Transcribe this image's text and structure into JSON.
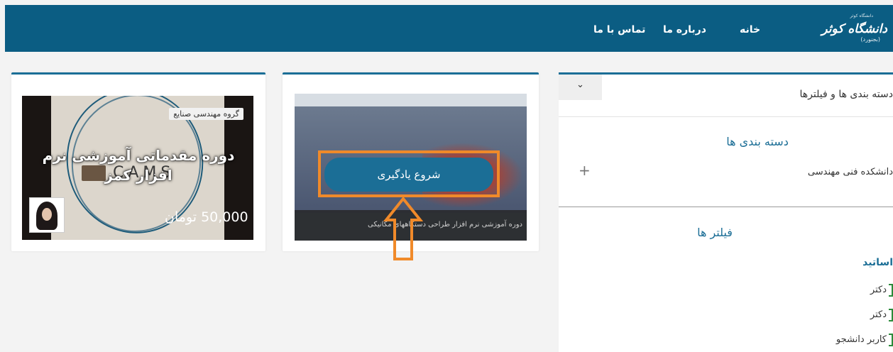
{
  "header": {
    "logo_small": "دانشگاه کوثر",
    "logo_text": "دانشگاه کوثر",
    "logo_sub": "(بجنورد)",
    "nav": [
      "خانه",
      "درباره ما",
      "تماس با ما"
    ]
  },
  "course1": {
    "tag": "گروه مهندسی صنایع",
    "title_line1": "دوره مقدماتی آموزشی نرم",
    "title_line2": "افزار کمز",
    "logo_word": "CAMS",
    "price": "50,000 تومان"
  },
  "course2": {
    "button_label": "شروع یادگیری",
    "caption": "دوره آموزشی نرم افزار طراحی دستگاههای مکانیکی"
  },
  "sidebar": {
    "collapse_icon": "chevron-down-icon",
    "heading": "دسته بندی ها و فیلترها",
    "categories_title": "دسته بندی ها",
    "category_item": "دانشکده فنی مهندسی",
    "expand_icon": "plus-icon",
    "filters_title": "فیلتر ها",
    "filter_group": "اساتید",
    "filter_options": [
      "دکتر",
      "دکتر",
      "کاربر دانشجو"
    ]
  },
  "colors": {
    "primary": "#0b5d83",
    "accent": "#1b6e96",
    "highlight": "#f08a2a",
    "checkbox": "#2a8a3a"
  }
}
